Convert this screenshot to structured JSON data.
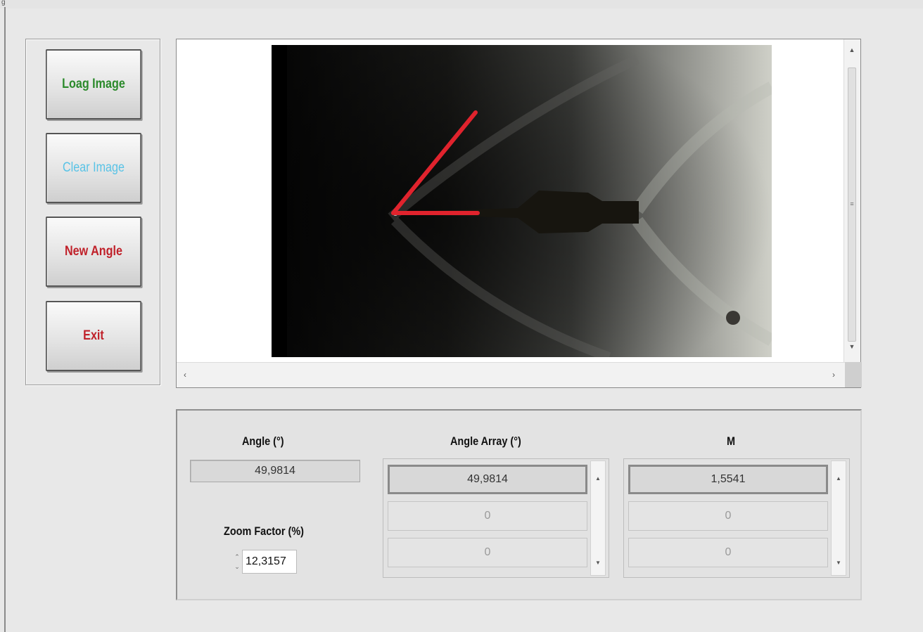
{
  "window": {
    "title_fragment": "g"
  },
  "buttons": {
    "load_image": "Loag Image",
    "clear_image": "Clear Image",
    "new_angle": "New Angle",
    "exit": "Exit"
  },
  "image_display": {
    "overlay_color": "#e0232d"
  },
  "panel": {
    "angle_label": "Angle (°)",
    "angle_value": "49,9814",
    "zoom_label": "Zoom Factor (%)",
    "zoom_value": "12,3157",
    "angle_array_label": "Angle Array (°)",
    "angle_array": [
      "49,9814",
      "0",
      "0"
    ],
    "m_label": "M",
    "m_array": [
      "1,5541",
      "0",
      "0"
    ]
  },
  "colors": {
    "load_button_text": "#2b8a2b",
    "clear_button_text": "#59c3e6",
    "new_angle_text": "#c0212a",
    "exit_text": "#c0212a"
  }
}
